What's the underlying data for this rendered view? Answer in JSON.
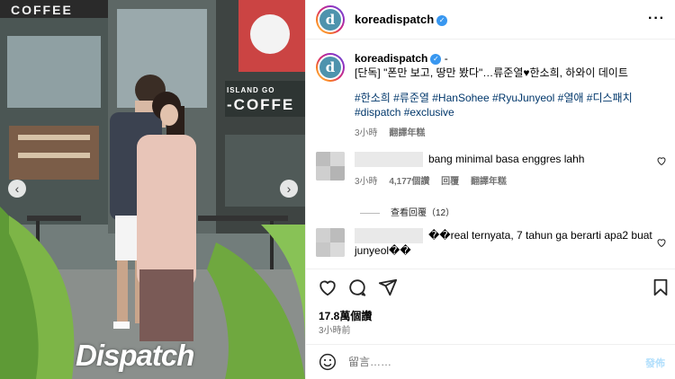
{
  "photo": {
    "sign_top": "COFFEE",
    "sign_island": "ISLAND GO",
    "sign_coffee": "-COFFE",
    "watermark": "Dispatch",
    "nav_prev_icon": "chevron-left-icon",
    "nav_next_icon": "chevron-right-icon",
    "prev_glyph": "‹",
    "next_glyph": "›"
  },
  "header": {
    "avatar_letter": "d",
    "username": "koreadispatch",
    "verified_glyph": "✓",
    "more_glyph": "···"
  },
  "caption": {
    "avatar_letter": "d",
    "username": "koreadispatch",
    "separator": "-",
    "text": "[단독] \"폰만 보고, 땅만 봤다\"…류준열♥한소희, 하와이 데이트",
    "hashtags": "#한소희 #류준열 #HanSohee #RyuJunyeol #열애 #디스패치 #dispatch #exclusive",
    "time": "3小時",
    "translate": "翻譯年糕"
  },
  "comments": [
    {
      "text": "bang minimal basa enggres lahh",
      "time": "3小時",
      "likes": "4,177個讚",
      "reply": "回覆",
      "translate": "翻譯年糕",
      "view_replies": "查看回覆（12）"
    },
    {
      "text": "��real ternyata, 7 tahun ga berarti apa2 buat junyeol��"
    }
  ],
  "actions": {
    "likes": "17.8萬個讚",
    "ago": "3小時前"
  },
  "composer": {
    "placeholder": "留言……",
    "post": "發佈"
  },
  "colors": {
    "link": "#00376b",
    "verified": "#3897f0",
    "muted": "#737373",
    "post_disabled": "#b2dffc"
  }
}
